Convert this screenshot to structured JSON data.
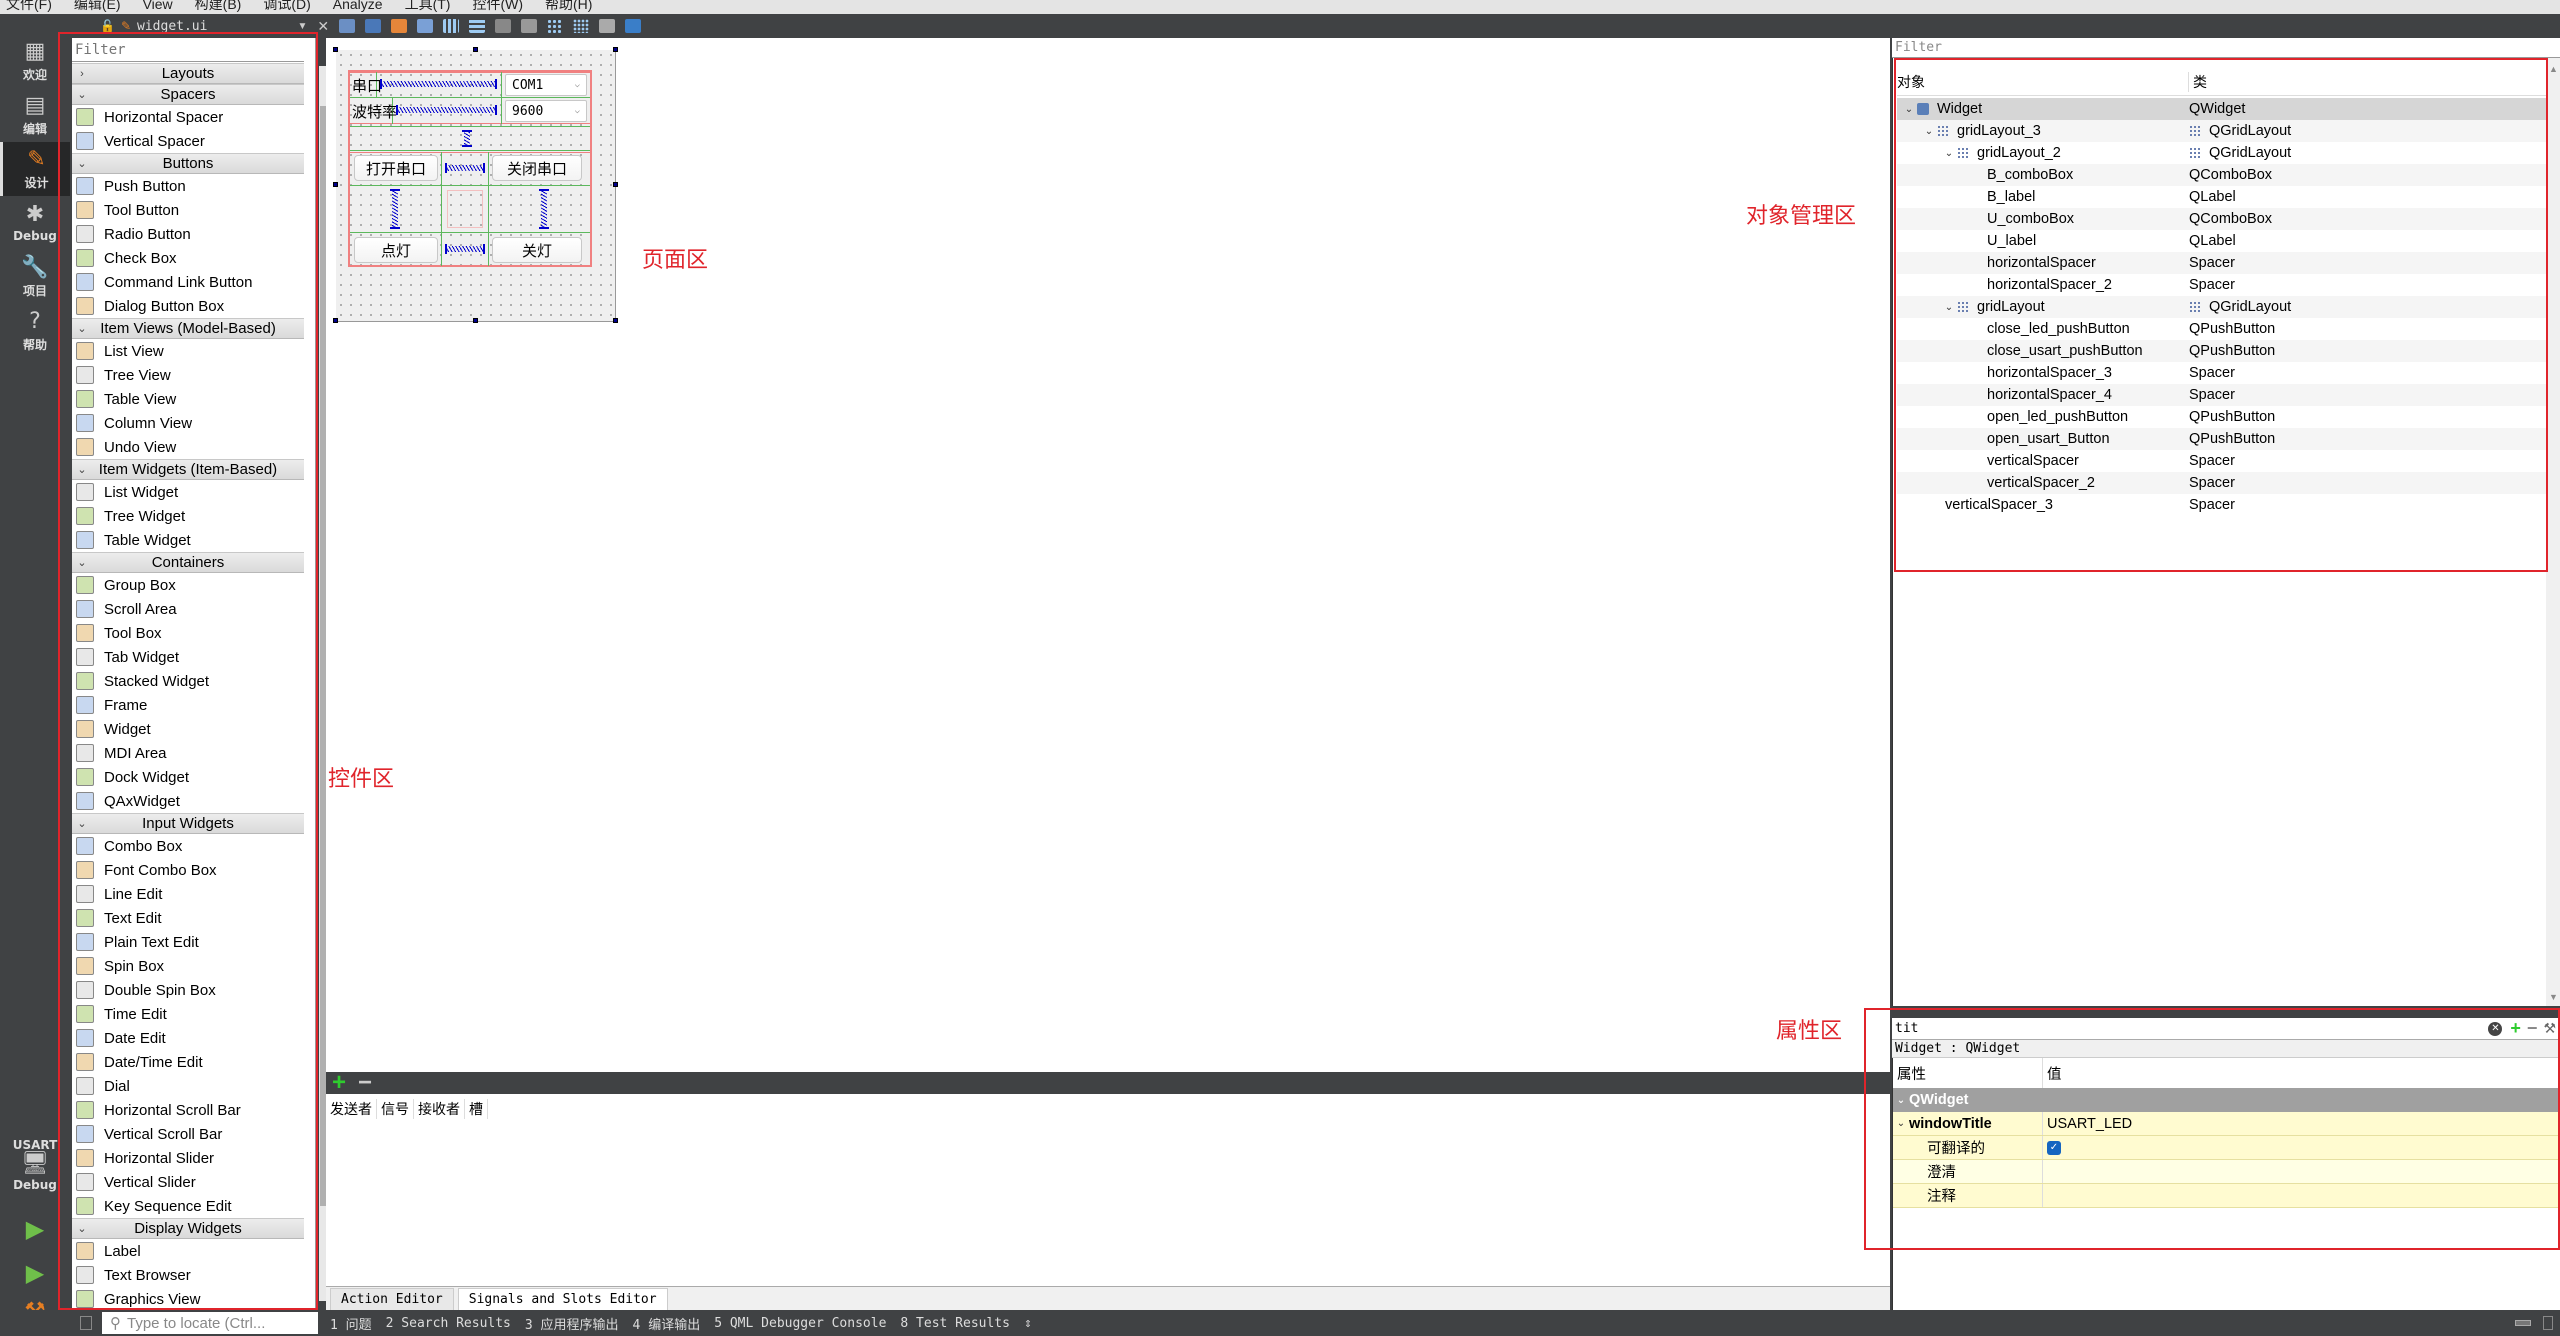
{
  "menu": [
    "文件(F)",
    "编辑(E)",
    "View",
    "构建(B)",
    "调试(D)",
    "Analyze",
    "工具(T)",
    "控件(W)",
    "帮助(H)"
  ],
  "modes": [
    {
      "label": "欢迎",
      "icon": "grid-icon"
    },
    {
      "label": "编辑",
      "icon": "document-icon"
    },
    {
      "label": "设计",
      "icon": "pencil-icon",
      "active": true
    },
    {
      "label": "Debug",
      "icon": "bug-icon"
    },
    {
      "label": "项目",
      "icon": "wrench-icon"
    },
    {
      "label": "帮助",
      "icon": "help-icon"
    }
  ],
  "kit": {
    "project": "USART",
    "build": "Debug"
  },
  "editor": {
    "filename": "widget.ui"
  },
  "widgetbox": {
    "filter_placeholder": "Filter",
    "categories": [
      {
        "name": "Layouts",
        "collapsed": true,
        "items": []
      },
      {
        "name": "Spacers",
        "items": [
          "Horizontal Spacer",
          "Vertical Spacer"
        ]
      },
      {
        "name": "Buttons",
        "items": [
          "Push Button",
          "Tool Button",
          "Radio Button",
          "Check Box",
          "Command Link Button",
          "Dialog Button Box"
        ]
      },
      {
        "name": "Item Views (Model-Based)",
        "items": [
          "List View",
          "Tree View",
          "Table View",
          "Column View",
          "Undo View"
        ]
      },
      {
        "name": "Item Widgets (Item-Based)",
        "items": [
          "List Widget",
          "Tree Widget",
          "Table Widget"
        ]
      },
      {
        "name": "Containers",
        "items": [
          "Group Box",
          "Scroll Area",
          "Tool Box",
          "Tab Widget",
          "Stacked Widget",
          "Frame",
          "Widget",
          "MDI Area",
          "Dock Widget",
          "QAxWidget"
        ]
      },
      {
        "name": "Input Widgets",
        "items": [
          "Combo Box",
          "Font Combo Box",
          "Line Edit",
          "Text Edit",
          "Plain Text Edit",
          "Spin Box",
          "Double Spin Box",
          "Time Edit",
          "Date Edit",
          "Date/Time Edit",
          "Dial",
          "Horizontal Scroll Bar",
          "Vertical Scroll Bar",
          "Horizontal Slider",
          "Vertical Slider",
          "Key Sequence Edit"
        ]
      },
      {
        "name": "Display Widgets",
        "items": [
          "Label",
          "Text Browser",
          "Graphics View"
        ]
      }
    ]
  },
  "form": {
    "port_label": "串口",
    "port_value": "COM1",
    "baud_label": "波特率",
    "baud_value": "9600",
    "open_port": "打开串口",
    "close_port": "关闭串口",
    "led_on": "点灯",
    "led_off": "关灯"
  },
  "annotations": {
    "widget_area": "控件区",
    "page_area": "页面区",
    "object_area": "对象管理区",
    "property_area": "属性区"
  },
  "signals": {
    "headers": [
      "发送者",
      "信号",
      "接收者",
      "槽"
    ],
    "tabs": [
      "Action Editor",
      "Signals and Slots Editor"
    ]
  },
  "objects": {
    "filter_placeholder": "Filter",
    "headers": [
      "对象",
      "类"
    ],
    "rows": [
      {
        "name": "Widget",
        "cls": "QWidget",
        "depth": 0,
        "expanded": true,
        "icon": "widget-icon"
      },
      {
        "name": "gridLayout_3",
        "cls": "QGridLayout",
        "depth": 1,
        "expanded": true,
        "icon": "grid-layout-icon"
      },
      {
        "name": "gridLayout_2",
        "cls": "QGridLayout",
        "depth": 2,
        "expanded": true,
        "icon": "grid-layout-icon"
      },
      {
        "name": "B_comboBox",
        "cls": "QComboBox",
        "depth": 3
      },
      {
        "name": "B_label",
        "cls": "QLabel",
        "depth": 3
      },
      {
        "name": "U_comboBox",
        "cls": "QComboBox",
        "depth": 3
      },
      {
        "name": "U_label",
        "cls": "QLabel",
        "depth": 3
      },
      {
        "name": "horizontalSpacer",
        "cls": "Spacer",
        "depth": 3
      },
      {
        "name": "horizontalSpacer_2",
        "cls": "Spacer",
        "depth": 3
      },
      {
        "name": "gridLayout",
        "cls": "QGridLayout",
        "depth": 2,
        "expanded": true,
        "icon": "grid-layout-icon"
      },
      {
        "name": "close_led_pushButton",
        "cls": "QPushButton",
        "depth": 3
      },
      {
        "name": "close_usart_pushButton",
        "cls": "QPushButton",
        "depth": 3
      },
      {
        "name": "horizontalSpacer_3",
        "cls": "Spacer",
        "depth": 3
      },
      {
        "name": "horizontalSpacer_4",
        "cls": "Spacer",
        "depth": 3
      },
      {
        "name": "open_led_pushButton",
        "cls": "QPushButton",
        "depth": 3
      },
      {
        "name": "open_usart_Button",
        "cls": "QPushButton",
        "depth": 3
      },
      {
        "name": "verticalSpacer",
        "cls": "Spacer",
        "depth": 3
      },
      {
        "name": "verticalSpacer_2",
        "cls": "Spacer",
        "depth": 3
      },
      {
        "name": "verticalSpacer_3",
        "cls": "Spacer",
        "depth": 2
      }
    ]
  },
  "properties": {
    "filter_value": "tit",
    "object": "Widget : QWidget",
    "headers": [
      "属性",
      "值"
    ],
    "group": "QWidget",
    "windowTitle_key": "windowTitle",
    "windowTitle_value": "USART_LED",
    "translatable_key": "可翻译的",
    "translatable_checked": true,
    "disambiguation_key": "澄清",
    "comment_key": "注释"
  },
  "statusbar": {
    "locate_placeholder": "Type to locate (Ctrl...",
    "outputs": [
      "1 问题",
      "2 Search Results",
      "3 应用程序输出",
      "4 编译输出",
      "5 QML Debugger Console",
      "8 Test Results"
    ]
  }
}
